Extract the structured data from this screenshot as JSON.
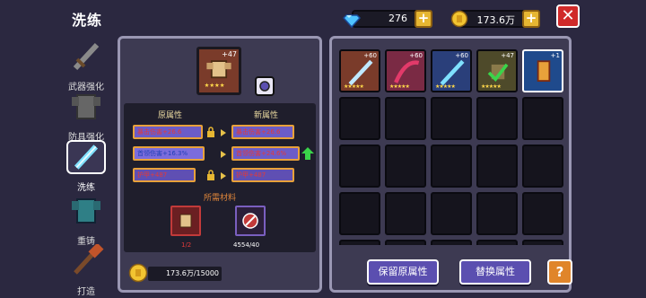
{
  "header": {
    "title": "洗练",
    "gems": "276",
    "gold": "173.6万"
  },
  "nav": [
    {
      "label": "武器强化",
      "icon": "sword-icon"
    },
    {
      "label": "防具强化",
      "icon": "armor-icon"
    },
    {
      "label": "洗练",
      "icon": "crystal-sword-icon"
    },
    {
      "label": "重铸",
      "icon": "reforge-armor-icon"
    },
    {
      "label": "打造",
      "icon": "forge-hammer-icon"
    }
  ],
  "active_nav_index": 2,
  "left_panel": {
    "main_item_level": "+47",
    "old_attr_header": "原属性",
    "new_attr_header": "新属性",
    "old_attrs": [
      "暴击伤害+26.6",
      "首领伤害+16.3%",
      "护甲+487"
    ],
    "new_attrs": [
      "暴击伤害+26.6",
      "首领伤害+24.6%",
      "护甲+487"
    ],
    "materials_header": "所需材料",
    "materials": [
      {
        "count": "1/2"
      },
      {
        "count": "4554/40"
      }
    ],
    "gold_cost": "173.6万/15000"
  },
  "inventory": [
    {
      "level": "+60",
      "color": "brown"
    },
    {
      "level": "+60",
      "color": "pink"
    },
    {
      "level": "+60",
      "color": "blue"
    },
    {
      "level": "+47",
      "color": "olive"
    },
    {
      "level": "+1",
      "color": "sel"
    }
  ],
  "buttons": {
    "keep_original": "保留原属性",
    "replace_attr": "替换属性",
    "help": "?"
  },
  "colors": {
    "accent_gold": "#e6b632",
    "close_red": "#d02a2a",
    "button_purple": "#5b4fb0",
    "help_orange": "#e0852a"
  }
}
